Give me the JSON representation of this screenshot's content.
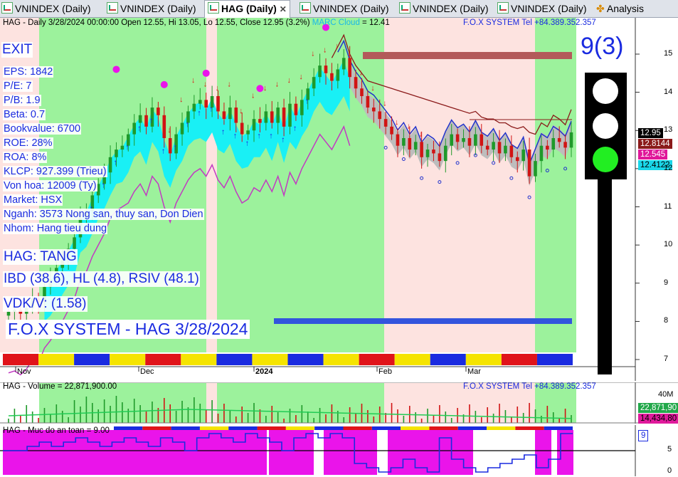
{
  "tabs": [
    {
      "label": "VNINDEX (Daily)",
      "active": false
    },
    {
      "label": "VNINDEX (Daily)",
      "active": false
    },
    {
      "label": "HAG (Daily)",
      "active": true
    },
    {
      "label": "VNINDEX (Daily)",
      "active": false
    },
    {
      "label": "VNINDEX (Daily)",
      "active": false
    },
    {
      "label": "VNINDEX (Daily)",
      "active": false
    },
    {
      "label": "Analysis",
      "active": false
    }
  ],
  "price_panel": {
    "header_main": "HAG - Daily 3/28/2024 00:00:00 Open 12.55, Hi 13.05, Lo 12.55, Close 12.95 (3.2%)",
    "header_marc": "MARC Cloud",
    "header_marc_value": " = 12.41",
    "header_right": "F.O.X SYSTEM Tel +84.389.352.357",
    "signal": "EXIT",
    "score": "9(3)",
    "fundamentals": [
      "EPS: 1842",
      "P/E: 7",
      "P/B: 1.9",
      "Beta: 0.7",
      "Bookvalue: 6700",
      "ROE: 28%",
      "ROA: 8%",
      "KLCP: 927.399 (Trieu)",
      "Von hoa: 12009 (Ty)",
      "Market: HSX",
      "Nganh: 3573 Nong san, thuy san, Don Dien",
      "Nhom: Hang tieu dung"
    ],
    "trend": "HAG: TANG",
    "ratings": "IBD (38.6), HL (4.8), RSIV (48.1)",
    "vdk": "VDK/V:  (1.58)",
    "title": "F.O.X SYSTEM - HAG 3/28/2024",
    "y_ticks": [
      "15",
      "14",
      "13",
      "12",
      "11",
      "10",
      "9",
      "8",
      "7"
    ],
    "price_tags": [
      {
        "text": "12.95",
        "bg": "#000000",
        "fg": "#ffffff"
      },
      {
        "text": "12.8144",
        "bg": "#8b1a1a",
        "fg": "#ffffff"
      },
      {
        "text": "12.545",
        "bg": "#e0189a",
        "fg": "#ffffff"
      },
      {
        "text": "12.4122",
        "bg": "#19d6e8",
        "fg": "#000000"
      }
    ],
    "x_labels": [
      "Nov",
      "Dec",
      "2024",
      "Feb",
      "Mar"
    ]
  },
  "volume_panel": {
    "header": "HAG - Volume = 22,871,900.00",
    "header_right": "F.O.X SYSTEM Tel +84.389.352.357",
    "y_tick": "40M",
    "tags": [
      {
        "text": "22,871,90",
        "bg": "#22a84a",
        "fg": "#ffffff"
      },
      {
        "text": "14,434,80",
        "bg": "#e01a9c",
        "fg": "#000000"
      }
    ]
  },
  "safety_panel": {
    "header": "HAG - Muc do an toan = 9.00",
    "y_ticks": [
      "5",
      "0"
    ],
    "tag": "9"
  },
  "colors": {
    "bull": "#1f9a2a",
    "bear": "#d11414",
    "up_zone": "#9cf29c",
    "down_zone": "#fde3e0",
    "cloud": "#19f0f5",
    "accent": "#1a2be0"
  },
  "chart_data": [
    {
      "type": "candlestick",
      "title": "HAG - Daily",
      "ylim": [
        6.7,
        15.9
      ],
      "x_labels": [
        "Nov",
        "Dec",
        "2024",
        "Feb",
        "Mar"
      ],
      "last_bar": {
        "date": "3/28/2024",
        "open": 12.55,
        "high": 13.05,
        "low": 12.55,
        "close": 12.95,
        "change_pct": 3.2
      },
      "close_series_approx": [
        8.25,
        8.3,
        8.2,
        8.35,
        8.6,
        8.5,
        8.9,
        9.1,
        9.4,
        9.6,
        9.9,
        10.2,
        10.7,
        10.9,
        11.3,
        11.6,
        11.9,
        12.3,
        12.5,
        12.6,
        12.9,
        13.2,
        13.4,
        13.1,
        13.6,
        13.4,
        12.8,
        12.4,
        12.9,
        13.2,
        13.5,
        13.7,
        13.8,
        13.6,
        13.9,
        13.5,
        13.3,
        13.6,
        13.2,
        12.9,
        13.0,
        13.3,
        13.2,
        13.5,
        13.2,
        13.6,
        13.1,
        13.7,
        13.4,
        13.8,
        14.1,
        14.4,
        14.7,
        14.5,
        14.3,
        14.6,
        14.9,
        14.4,
        14.1,
        13.9,
        13.6,
        13.5,
        13.3,
        13.1,
        12.9,
        12.6,
        12.8,
        12.5,
        12.7,
        12.3,
        12.5,
        12.4,
        12.2,
        12.6,
        12.9,
        12.7,
        12.8,
        12.6,
        12.9,
        12.6,
        12.5,
        12.7,
        12.4,
        12.6,
        12.3,
        12.2,
        12.5,
        11.8,
        12.2,
        12.6,
        12.5,
        12.8,
        12.7,
        12.55,
        12.95
      ]
    },
    {
      "type": "bar",
      "title": "HAG - Volume",
      "last_value": 22871900,
      "average_value": 14434800
    },
    {
      "type": "line",
      "title": "HAG - Muc do an toan",
      "last_value": 9,
      "ylim": [
        0,
        9
      ]
    }
  ]
}
